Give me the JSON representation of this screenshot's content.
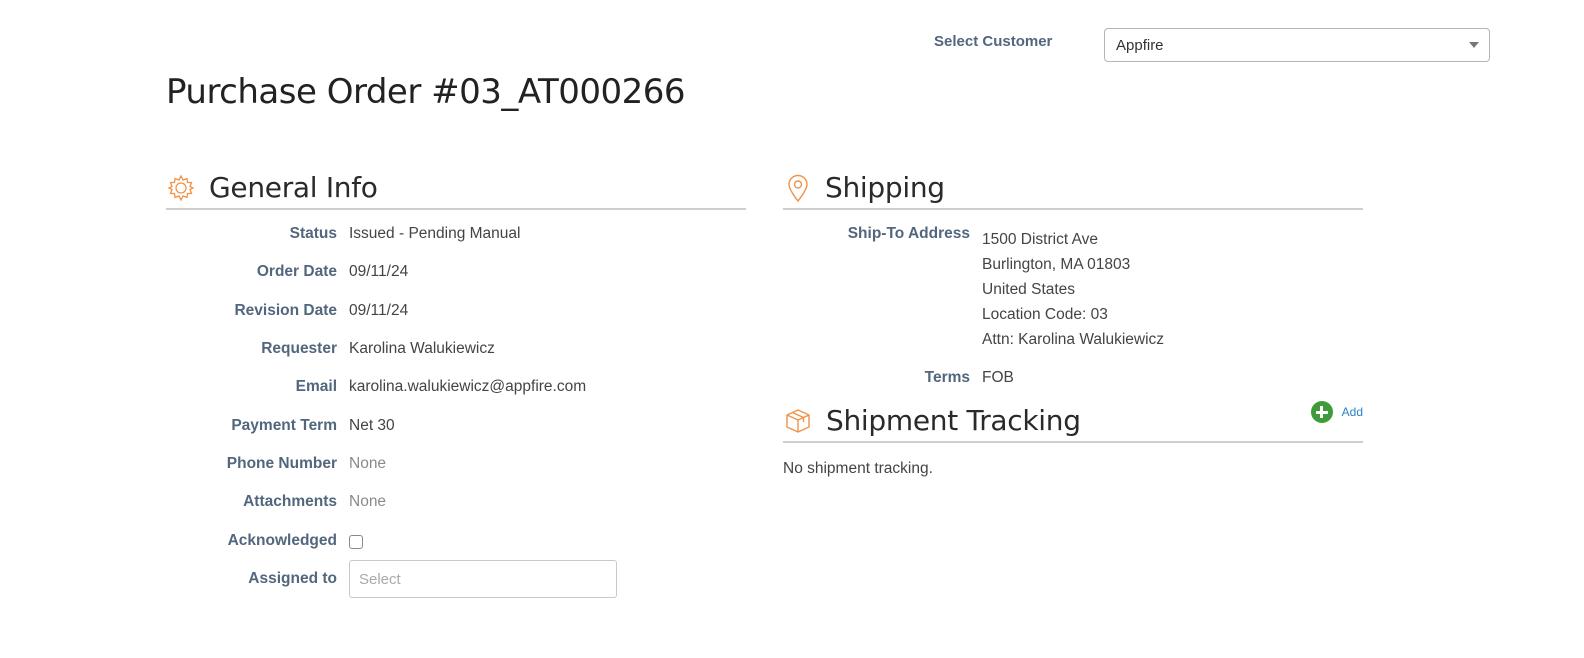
{
  "customer_selector": {
    "label": "Select Customer",
    "selected": "Appfire"
  },
  "page_title": "Purchase Order #03_AT000266",
  "general_info": {
    "title": "General Info",
    "icon": "gear-icon",
    "fields": {
      "status": {
        "label": "Status",
        "value": "Issued - Pending Manual"
      },
      "order_date": {
        "label": "Order Date",
        "value": "09/11/24"
      },
      "revision_date": {
        "label": "Revision Date",
        "value": "09/11/24"
      },
      "requester": {
        "label": "Requester",
        "value": "Karolina Walukiewicz"
      },
      "email": {
        "label": "Email",
        "value": "karolina.walukiewicz@appfire.com"
      },
      "payment_term": {
        "label": "Payment Term",
        "value": "Net 30"
      },
      "phone_number": {
        "label": "Phone Number",
        "value": "None"
      },
      "attachments": {
        "label": "Attachments",
        "value": "None"
      },
      "acknowledged": {
        "label": "Acknowledged",
        "checked": false
      },
      "assigned_to": {
        "label": "Assigned to",
        "placeholder": "Select"
      }
    }
  },
  "shipping": {
    "title": "Shipping",
    "icon": "map-pin-icon",
    "ship_to_label": "Ship-To Address",
    "address_lines": [
      "1500 District Ave",
      "Burlington, MA 01803",
      "United States",
      "Location Code: 03",
      "Attn: Karolina Walukiewicz"
    ],
    "terms_label": "Terms",
    "terms_value": "FOB"
  },
  "shipment_tracking": {
    "title": "Shipment Tracking",
    "icon": "package-icon",
    "add_label": "Add",
    "empty_message": "No shipment tracking."
  },
  "colors": {
    "label": "#52667d",
    "accent_orange": "#f0924a",
    "add_green": "#3f9a3a",
    "link_blue": "#2b7fc3"
  }
}
